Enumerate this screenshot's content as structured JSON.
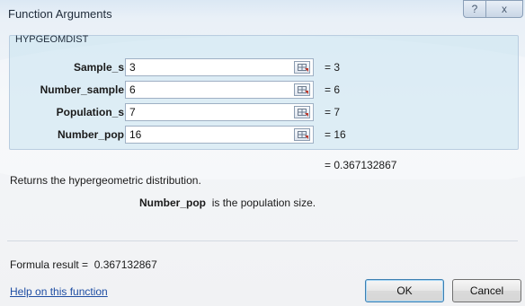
{
  "window": {
    "title": "Function Arguments",
    "help_label": "?",
    "close_label": "x"
  },
  "function": {
    "name": "HYPGEOMDIST"
  },
  "arguments": [
    {
      "label": "Sample_s",
      "value": "3",
      "evaluated": "= 3"
    },
    {
      "label": "Number_sample",
      "value": "6",
      "evaluated": "= 6"
    },
    {
      "label": "Population_s",
      "value": "7",
      "evaluated": "= 7"
    },
    {
      "label": "Number_pop",
      "value": "16",
      "evaluated": "= 16"
    }
  ],
  "result": {
    "evaluated": "= 0.367132867"
  },
  "description": "Returns the hypergeometric distribution.",
  "param_help": {
    "name": "Number_pop",
    "text": "is the population size."
  },
  "formula": {
    "label": "Formula result =",
    "value": "0.367132867"
  },
  "footer": {
    "help_link": "Help on this function",
    "ok_label": "OK",
    "cancel_label": "Cancel"
  },
  "icons": {
    "collapse": "range-select-icon"
  },
  "colors": {
    "accent": "#c8e4f0",
    "link": "#1f4ea3"
  }
}
